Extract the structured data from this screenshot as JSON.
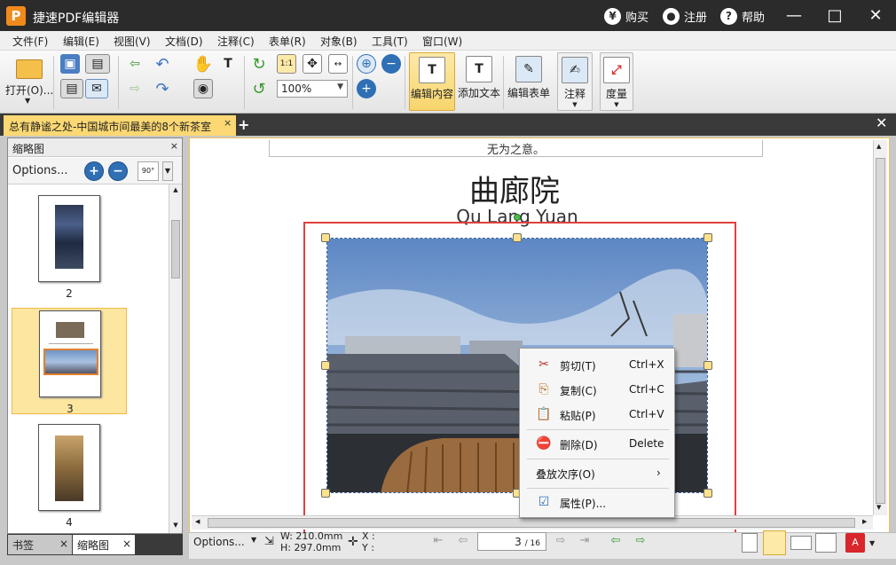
{
  "app": {
    "logo": "P",
    "title": "捷速PDF编辑器"
  },
  "titlebar_actions": [
    {
      "label": "购买",
      "icon": "yen-icon",
      "glyph": "¥"
    },
    {
      "label": "注册",
      "icon": "user-icon",
      "glyph": "●"
    },
    {
      "label": "帮助",
      "icon": "help-icon",
      "glyph": "?"
    }
  ],
  "window_controls": {
    "minimize": "—",
    "maximize": "□",
    "close": "✕"
  },
  "menu": [
    "文件(F)",
    "编辑(E)",
    "视图(V)",
    "文档(D)",
    "注释(C)",
    "表单(R)",
    "对象(B)",
    "工具(T)",
    "窗口(W)"
  ],
  "toolbar": {
    "open_label": "打开(O)...",
    "zoom_value": "100%",
    "edit_content": "编辑内容",
    "add_text": "添加文本",
    "edit_form": "编辑表单",
    "annotate": "注释",
    "measure": "度量",
    "actual_size": "1:1"
  },
  "tabs": {
    "document": "总有静谧之处-中国城市间最美的8个新茶室",
    "close": "×",
    "add": "+",
    "close_all": "✕"
  },
  "left_panel": {
    "title": "缩略图",
    "close": "×",
    "options": "Options...",
    "rotate": "90°",
    "thumbs": [
      "2",
      "3",
      "4"
    ],
    "selected": "3",
    "bottom_tabs": [
      {
        "label": "书签",
        "close": "×"
      },
      {
        "label": "缩略图",
        "close": "×"
      }
    ]
  },
  "page": {
    "header_text": "无为之意。",
    "title": "曲廊院",
    "subtitle": "Qu Lang Yuan"
  },
  "context_menu": [
    {
      "label": "剪切(T)",
      "shortcut": "Ctrl+X",
      "icon": "scissors-icon",
      "glyph": "✂"
    },
    {
      "label": "复制(C)",
      "shortcut": "Ctrl+C",
      "icon": "copy-icon",
      "glyph": "⎘"
    },
    {
      "label": "粘贴(P)",
      "shortcut": "Ctrl+V",
      "icon": "paste-icon",
      "glyph": "📋"
    },
    {
      "label": "删除(D)",
      "shortcut": "Delete",
      "icon": "delete-icon",
      "glyph": "⛔"
    },
    {
      "label": "叠放次序(O)",
      "shortcut": "›",
      "icon": "",
      "glyph": ""
    },
    {
      "label": "属性(P)...",
      "shortcut": "",
      "icon": "properties-icon",
      "glyph": "☑"
    }
  ],
  "statusbar": {
    "options": "Options...",
    "width": "W: 210.0mm",
    "height": "H: 297.0mm",
    "x": "X :",
    "y": "Y :",
    "current_page": "3",
    "total_pages": "/ 16"
  },
  "colors": {
    "titlebar": "#2b2b2b",
    "tab_active": "#fbd873",
    "selection_red": "#e04040",
    "accent_blue": "#2f6fb4"
  }
}
